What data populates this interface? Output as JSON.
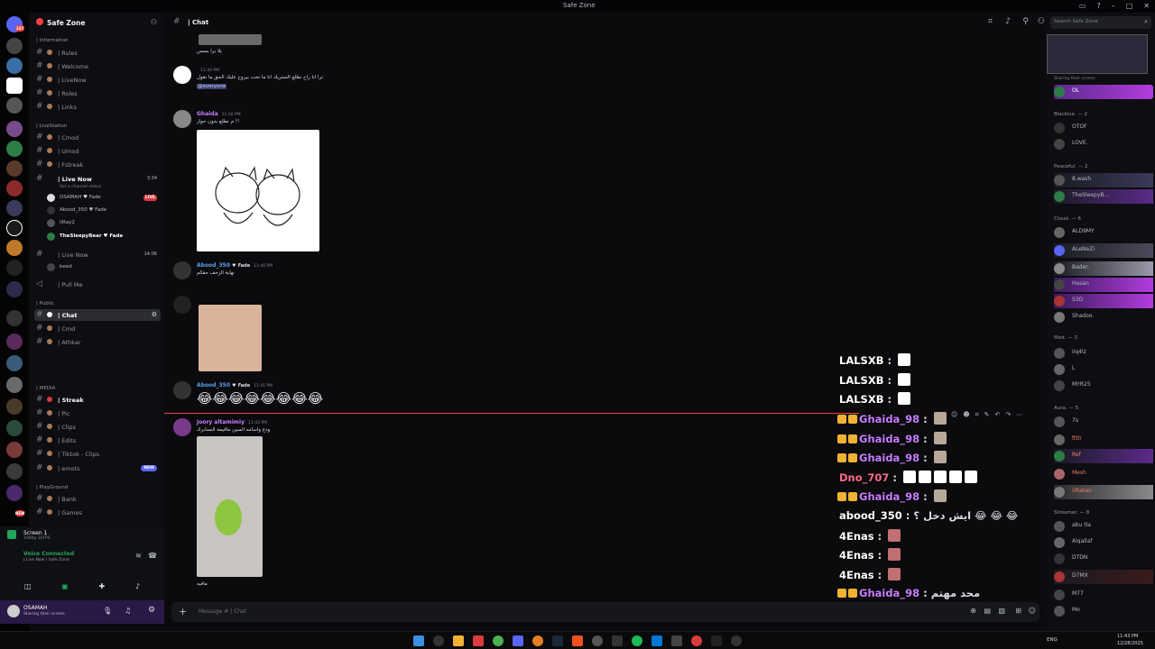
{
  "window": {
    "title": "Safe Zone"
  },
  "guild": {
    "name": "Safe Zone"
  },
  "channels": {
    "cat_information": "| Information",
    "cat_livestation": "| LiveStation",
    "cat_public": "| Public",
    "cat_media": "| MEDIA",
    "cat_playground": "| PlayGround",
    "rules": "| Rules",
    "welcome": "| Welcome",
    "livenow": "| LiveNow",
    "roles": "| Roles",
    "links": "| Links",
    "cmod": "| Cmod",
    "umod": "| Umod",
    "fstreak": "| Fstreak",
    "live_now_voice": "| Live Now",
    "live_now_voice_time": "3:34",
    "live_now_voice2": "| Live Now",
    "live_now_voice2_time": "14:06",
    "pull_me": "| Pull Me",
    "chat": "| Chat",
    "cmd": "| Cmd",
    "athkar": "| Athkar",
    "streak": "| Streak",
    "pic": "| Pic",
    "clips": "| Clips",
    "edits": "| Edits",
    "tiktok_clips": "| Tiktok - Clips",
    "emots": "| emots",
    "bank": "| Bank",
    "games": "| Games"
  },
  "voice_users": [
    {
      "name": "OSAMAH",
      "tag": "Fade",
      "live": "LIVE"
    },
    {
      "name": "Abood_350",
      "tag": "Fade"
    },
    {
      "name": "liRay2"
    },
    {
      "name": "TheSleepyBear",
      "tag": "Fade"
    },
    {
      "name": "beed"
    }
  ],
  "voice_status": "Set a channel status",
  "badges": {
    "new": "NEW"
  },
  "stream_panel": {
    "title": "Screen 1",
    "subtitle": "1080p 30FPS"
  },
  "voice_panel": {
    "status": "Voice Connected",
    "channel": "| Live Now / Safe Zone"
  },
  "user_panel": {
    "name": "OSAMAH",
    "status": "Sharing their screen"
  },
  "chat": {
    "header": "| Chat",
    "composer_placeholder": "Message #  | Chat",
    "messages": [
      {
        "text": "يلا برا يسس"
      },
      {
        "name": "",
        "time": "11:30 PM",
        "text": "ترا انا راح نطلع الستريك انا ما تحت بيروح عليك الحق ما تقول",
        "mention": "@everyone"
      },
      {
        "name": "Ghaida",
        "time": "11:30 PM",
        "text": "م نطلع بدون حواز !!"
      },
      {
        "name": "Abood_350",
        "tag": "Fade",
        "time": "11:40 PM",
        "text": "نهاية الرحف حقكم"
      },
      {
        "name": "Abood_350",
        "tag": "Fade",
        "time": "11:41 PM",
        "text": "😂😂😂😂😂😂😂😂"
      },
      {
        "name": "Joory altamimiy",
        "time": "11:43 PM",
        "text": "ودع واسامه المبين ماقيمة السنابرك"
      },
      {
        "text": "مافيه"
      }
    ]
  },
  "overlay": [
    {
      "user": "LALSXB",
      "color": "#ffffff",
      "text": ""
    },
    {
      "user": "LALSXB",
      "color": "#ffffff",
      "text": ""
    },
    {
      "user": "LALSXB",
      "color": "#ffffff",
      "text": ""
    },
    {
      "user": "Ghaida_98",
      "color": "#c77dff",
      "text": ""
    },
    {
      "user": "Ghaida_98",
      "color": "#c77dff",
      "text": ""
    },
    {
      "user": "Ghaida_98",
      "color": "#c77dff",
      "text": ""
    },
    {
      "user": "Dno_707",
      "color": "#ff6b8a",
      "text": ""
    },
    {
      "user": "Ghaida_98",
      "color": "#c77dff",
      "text": ""
    },
    {
      "user": "abood_350",
      "color": "#ffffff",
      "text": "ايش دخل ؟ 😂 😂 😂"
    },
    {
      "user": "4Enas",
      "color": "#ffffff",
      "text": ""
    },
    {
      "user": "4Enas",
      "color": "#ffffff",
      "text": ""
    },
    {
      "user": "4Enas",
      "color": "#ffffff",
      "text": ""
    },
    {
      "user": "Ghaida_98",
      "color": "#c77dff",
      "text": "محد مهتم"
    }
  ],
  "members": {
    "search_placeholder": "Search Safe Zone",
    "categories": [
      "Blackice. — 2",
      "Peaceful. — 2",
      "Cloud. — 6",
      "Mod. — 3",
      "Aura. — 5",
      "Streamer. — 8"
    ],
    "list": [
      {
        "name": "Sharing their screen"
      },
      {
        "name": "OL"
      },
      {
        "name": "OTOF"
      },
      {
        "name": "LOVE."
      },
      {
        "name": "8.wash",
        "status": "24 NOV"
      },
      {
        "name": "TheSleepyB...",
        "status": "Fade"
      },
      {
        "name": "ALD9MY",
        "status": "Don't stop, success isn't that ..."
      },
      {
        "name": "ALeNeZi",
        "status": "CHIL"
      },
      {
        "name": "Bader."
      },
      {
        "name": "Hasan",
        "status": "Ain"
      },
      {
        "name": "S3D"
      },
      {
        "name": "Shadoo.",
        "status": "Mani"
      },
      {
        "name": "iiq4lz"
      },
      {
        "name": "L"
      },
      {
        "name": "MYR25"
      },
      {
        "name": "7s",
        "status": "Live kick.s/7s"
      },
      {
        "name": "fttlr"
      },
      {
        "name": "Ref",
        "status": "discord.gg/HJJU"
      },
      {
        "name": "Mesh"
      },
      {
        "name": "iiRakan"
      },
      {
        "name": "abu tla"
      },
      {
        "name": "Alqallaf",
        "status": "OL"
      },
      {
        "name": "DTDN",
        "status": "DTDN"
      },
      {
        "name": "D7MX"
      },
      {
        "name": "M77",
        "status": "Ain"
      },
      {
        "name": "Mo",
        "status": "kick: vej23"
      }
    ]
  },
  "taskbar": {
    "lang": "ENG",
    "time": "11:43 PM",
    "date": "12/28/2025"
  },
  "colors": {
    "accent": "#5865f2",
    "live": "#da373c",
    "bg": "#0b0b0e"
  }
}
